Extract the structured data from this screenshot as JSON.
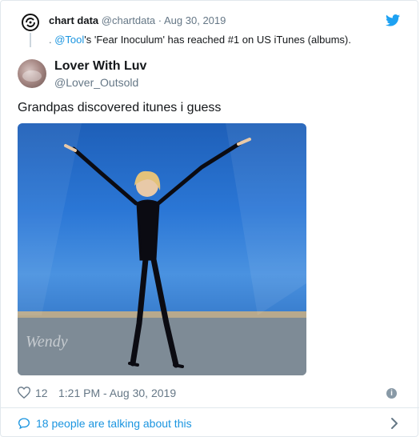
{
  "quoted": {
    "name": "chart data",
    "handle": "@chartdata",
    "separator": " · ",
    "date": "Aug 30, 2019",
    "prefix": ". ",
    "mention": "@Tool",
    "text": "'s 'Fear Inoculum' has reached #1 on US iTunes (albums)."
  },
  "tweet": {
    "author_name": "Lover With Luv",
    "author_handle": "@Lover_Outsold",
    "text": "Grandpas discovered itunes i guess",
    "media_watermark": "Wendy",
    "like_count": "12",
    "timestamp": "1:21 PM - Aug 30, 2019"
  },
  "footer": {
    "talking_text": "18 people are talking about this"
  },
  "colors": {
    "link": "#1b95e0",
    "muted": "#657786",
    "border": "#e1e8ed"
  },
  "icons": [
    "chartdata-logo-icon",
    "twitter-bird-icon",
    "heart-icon",
    "info-icon",
    "comment-bubble-icon",
    "chevron-right-icon"
  ]
}
